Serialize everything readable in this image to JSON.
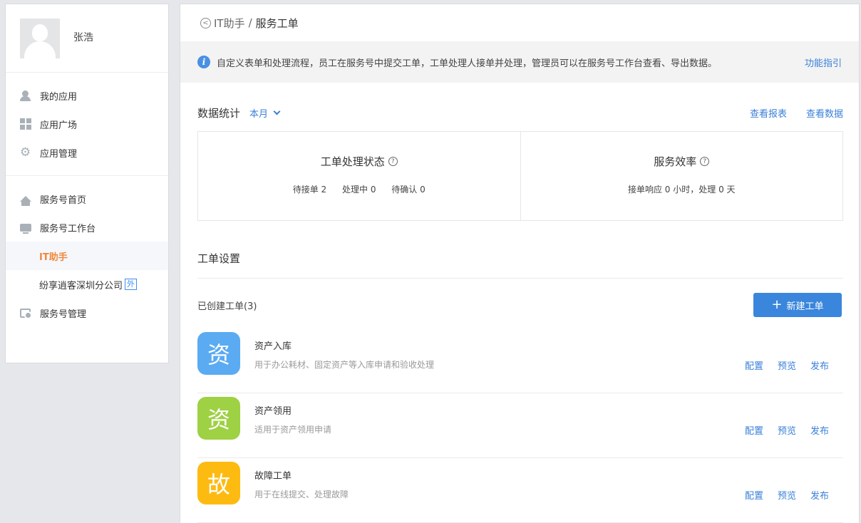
{
  "user": {
    "name": "张浩"
  },
  "sidebar": {
    "group1": [
      {
        "label": "我的应用",
        "icon": "user-icon"
      },
      {
        "label": "应用广场",
        "icon": "grid-icon"
      },
      {
        "label": "应用管理",
        "icon": "gear-icon"
      }
    ],
    "group2": {
      "home": "服务号首页",
      "workbench": "服务号工作台",
      "sub_items": [
        {
          "label": "IT助手",
          "active": true
        },
        {
          "label": "纷享逍客深圳分公司",
          "badge": "外"
        }
      ],
      "manage": "服务号管理"
    }
  },
  "breadcrumb": {
    "parent": "IT助手",
    "separator": "/",
    "current": "服务工单"
  },
  "info": {
    "text": "自定义表单和处理流程，员工在服务号中提交工单，工单处理人接单并处理，管理员可以在服务号工作台查看、导出数据。",
    "guide_link": "功能指引"
  },
  "stats": {
    "title": "数据统计",
    "period": "本月",
    "report_link": "查看报表",
    "data_link": "查看数据",
    "status": {
      "title": "工单处理状态",
      "pending": "待接单 2",
      "processing": "处理中 0",
      "confirming": "待确认 0"
    },
    "efficiency": {
      "title": "服务效率",
      "value": "接单响应 0 小时，处理 0 天"
    }
  },
  "settings": {
    "title": "工单设置",
    "created": "已创建工单(3)",
    "new_button": "新建工单",
    "action_config": "配置",
    "action_preview": "预览",
    "action_publish": "发布",
    "items": [
      {
        "glyph": "资",
        "color": "#5aabf2",
        "name": "资产入库",
        "desc": "用于办公耗材、固定资产等入库申请和验收处理"
      },
      {
        "glyph": "资",
        "color": "#9ed143",
        "name": "资产领用",
        "desc": "适用于资产领用申请"
      },
      {
        "glyph": "故",
        "color": "#fdbb11",
        "name": "故障工单",
        "desc": "用于在线提交、处理故障"
      }
    ]
  }
}
